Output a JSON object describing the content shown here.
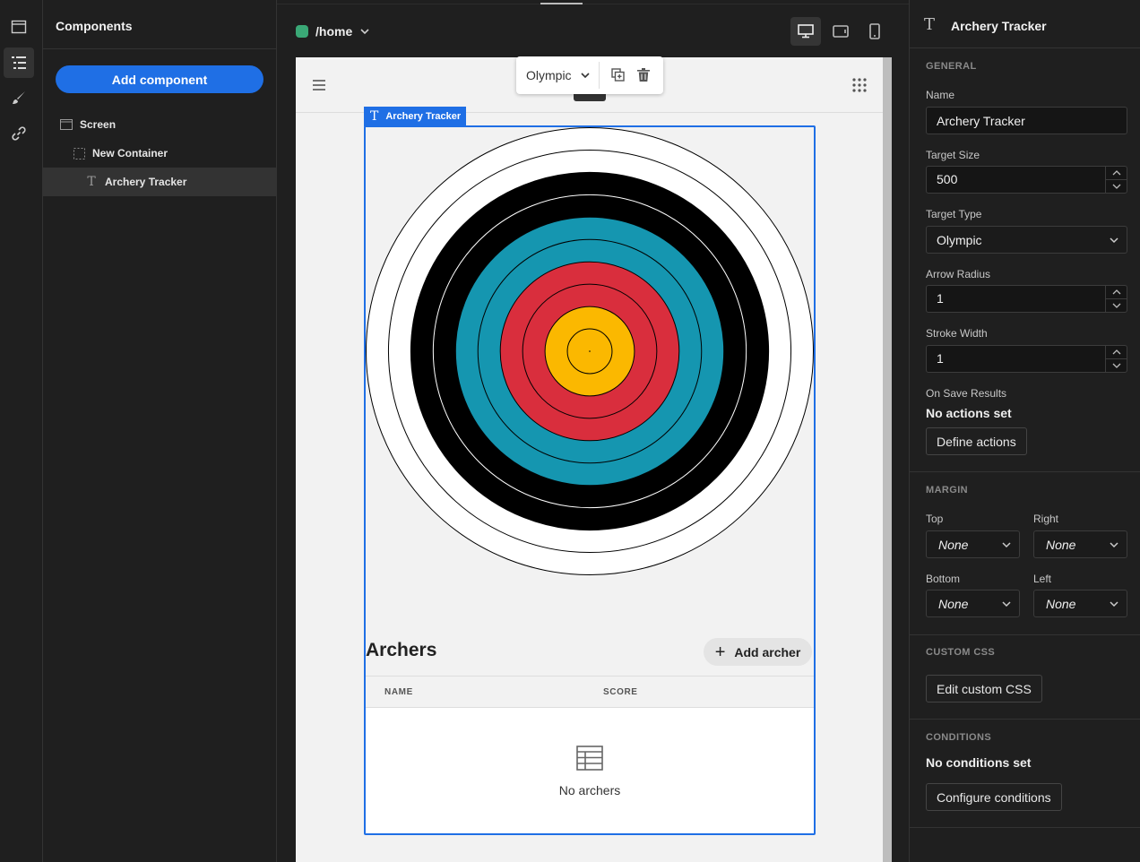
{
  "route": {
    "path": "/home",
    "dot_color": "#3aa876"
  },
  "components_panel": {
    "title": "Components",
    "add_button": "Add component",
    "tree": [
      {
        "label": "Screen",
        "icon": "screen-icon"
      },
      {
        "label": "New Container",
        "icon": "container-icon"
      },
      {
        "label": "Archery Tracker",
        "icon": "text-component-icon",
        "selected": true
      }
    ]
  },
  "floating_toolbar": {
    "selected_option": "Olympic"
  },
  "selection": {
    "label": "Archery Tracker"
  },
  "target": {
    "rings": [
      "#ffffff",
      "#ffffff",
      "#000000",
      "#000000",
      "#1596b0",
      "#1596b0",
      "#d92e3d",
      "#d92e3d",
      "#fbb800",
      "#fbb800"
    ],
    "stroke_color": "#000000",
    "line_color_on_black": "#ffffff"
  },
  "archers": {
    "title": "Archers",
    "add_button": "Add archer",
    "columns": [
      "NAME",
      "SCORE"
    ],
    "empty_text": "No archers"
  },
  "settings": {
    "title": "Archery Tracker",
    "general_title": "GENERAL",
    "name_label": "Name",
    "name_value": "Archery Tracker",
    "target_size_label": "Target Size",
    "target_size_value": "500",
    "target_type_label": "Target Type",
    "target_type_value": "Olympic",
    "arrow_radius_label": "Arrow Radius",
    "arrow_radius_value": "1",
    "stroke_width_label": "Stroke Width",
    "stroke_width_value": "1",
    "on_save_label": "On Save Results",
    "no_actions": "No actions set",
    "define_actions": "Define actions",
    "margin_title": "MARGIN",
    "margin_top_label": "Top",
    "margin_top_value": "None",
    "margin_right_label": "Right",
    "margin_right_value": "None",
    "margin_bottom_label": "Bottom",
    "margin_bottom_value": "None",
    "margin_left_label": "Left",
    "margin_left_value": "None",
    "custom_css_title": "CUSTOM CSS",
    "edit_css": "Edit custom CSS",
    "conditions_title": "CONDITIONS",
    "no_conditions": "No conditions set",
    "configure_conditions": "Configure conditions"
  },
  "colors": {
    "accent": "#1f6fe5",
    "panel_bg": "#1f1f1f",
    "canvas_bg": "#f2f2f2"
  }
}
